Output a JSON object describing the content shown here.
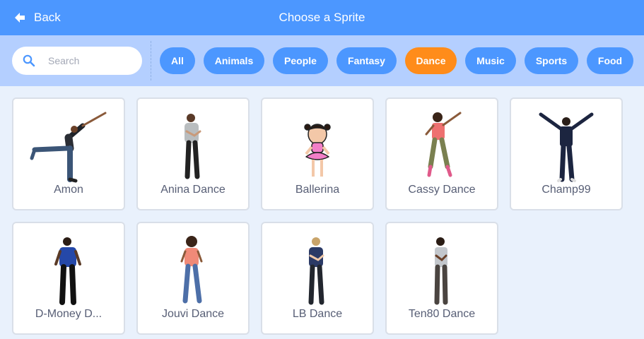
{
  "header": {
    "back_label": "Back",
    "title": "Choose a Sprite"
  },
  "search": {
    "placeholder": "Search",
    "value": ""
  },
  "tags": [
    {
      "label": "All",
      "selected": false
    },
    {
      "label": "Animals",
      "selected": false
    },
    {
      "label": "People",
      "selected": false
    },
    {
      "label": "Fantasy",
      "selected": false
    },
    {
      "label": "Dance",
      "selected": true
    },
    {
      "label": "Music",
      "selected": false
    },
    {
      "label": "Sports",
      "selected": false
    },
    {
      "label": "Food",
      "selected": false
    }
  ],
  "sprites": [
    {
      "name": "Amon"
    },
    {
      "name": "Anina Dance"
    },
    {
      "name": "Ballerina"
    },
    {
      "name": "Cassy Dance"
    },
    {
      "name": "Champ99"
    },
    {
      "name": "D-Money D..."
    },
    {
      "name": "Jouvi Dance"
    },
    {
      "name": "LB Dance"
    },
    {
      "name": "Ten80 Dance"
    }
  ],
  "colors": {
    "header": "#4c97ff",
    "filter_bar": "#b4cfff",
    "tag": "#4c97ff",
    "tag_selected": "#ff8c1a",
    "background": "#e9f1fc",
    "text": "#575e75"
  }
}
